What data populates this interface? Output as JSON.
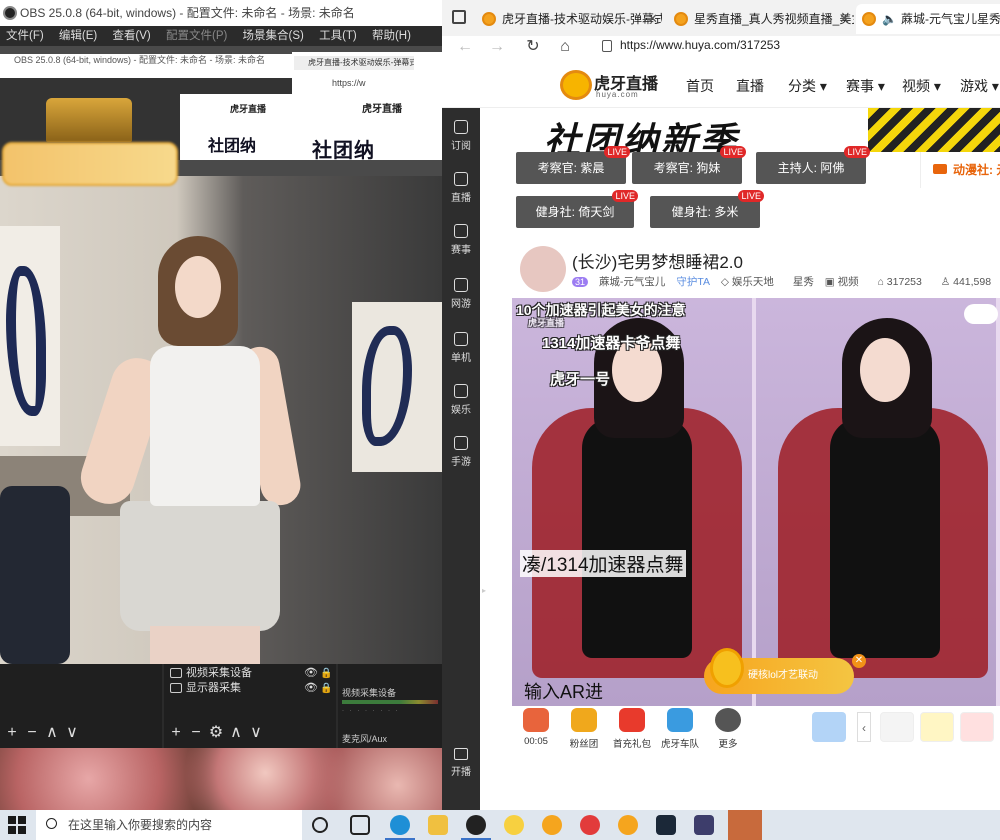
{
  "obs": {
    "title": "OBS 25.0.8 (64-bit, windows) - 配置文件: 未命名 - 场景: 未命名",
    "menu": [
      "文件(F)",
      "编辑(E)",
      "查看(V)",
      "配置文件(P)",
      "场景集合(S)",
      "工具(T)",
      "帮助(H)"
    ],
    "nested_title": "OBS 25.0.8 (64-bit, windows) - 配置文件: 未命名 - 场景: 未命名",
    "nested_tab": "虎牙直播-技术驱动娱乐-弹幕式...",
    "nested_url": "https://w",
    "nested_logo": "虎牙直播",
    "nested_banner": "社团纳",
    "nested_banner2": "社团纳",
    "sources": [
      {
        "label": "视频采集设备"
      },
      {
        "label": "显示器采集"
      }
    ],
    "mixer": {
      "track1": "视频采集设备",
      "track2": "麦克风/Aux"
    },
    "dock_tools": [
      "+",
      "−",
      "∧",
      "∨"
    ],
    "source_tools": [
      "+",
      "−",
      "⚙",
      "∧",
      "∨"
    ]
  },
  "browser": {
    "tabs": [
      {
        "title": "虎牙直播-技术驱动娱乐-弹幕式直"
      },
      {
        "title": "星秀直播_真人秀视频直播_美女"
      },
      {
        "title": "蔴城-元气宝儿星秀直播_蔴"
      }
    ],
    "url": "https://www.huya.com/317253",
    "logo_text": "虎牙直播",
    "logo_sub": "huya.com",
    "nav": [
      "首页",
      "直播",
      "分类 ▾",
      "赛事 ▾",
      "视频 ▾",
      "游戏 ▾"
    ],
    "sidebar": [
      "订阅",
      "直播",
      "赛事",
      "网游",
      "单机",
      "娱乐",
      "手游"
    ],
    "open_live": "开播",
    "banner_title": "社团纳新季",
    "anchors_row1": [
      {
        "label": "考察官: 紫晨",
        "badge": "LIVE"
      },
      {
        "label": "考察官: 狗妹",
        "badge": "LIVE"
      },
      {
        "label": "主持人: 阿佛",
        "badge": "LIVE"
      }
    ],
    "anchors_row2": [
      {
        "label": "健身社: 倚天剑",
        "badge": "LIVE"
      },
      {
        "label": "健身社: 多米",
        "badge": "LIVE"
      }
    ],
    "anime_tab": "动漫社: 元气宝",
    "room": {
      "title": "(长沙)宅男梦想睡裙2.0",
      "level": "31",
      "host": "蔴城-元气宝儿",
      "guard": "守护TA",
      "category": "娱乐天地",
      "subcategory": "星秀",
      "video": "视频",
      "room_id": "317253",
      "viewers": "441,598"
    },
    "video_overlays": {
      "line1": "10个加速器引起美女的注意",
      "line2": "1314加速器卡爷点舞",
      "line3": "虎牙一号",
      "caption": "凑/1314加速器点舞",
      "input_hint": "输入AR进",
      "watermark": "虎牙直播",
      "promo": "硬核lol才艺联动"
    },
    "gifts": [
      {
        "label": "00:05",
        "color": "#e8643c"
      },
      {
        "label": "粉丝团",
        "color": "#f0a81c"
      },
      {
        "label": "首充礼包",
        "color": "#e83a2c"
      },
      {
        "label": "虎牙车队",
        "color": "#3a9be0"
      },
      {
        "label": "更多",
        "color": "#555555"
      }
    ]
  },
  "taskbar": {
    "search_placeholder": "在这里输入你要搜索的内容"
  }
}
